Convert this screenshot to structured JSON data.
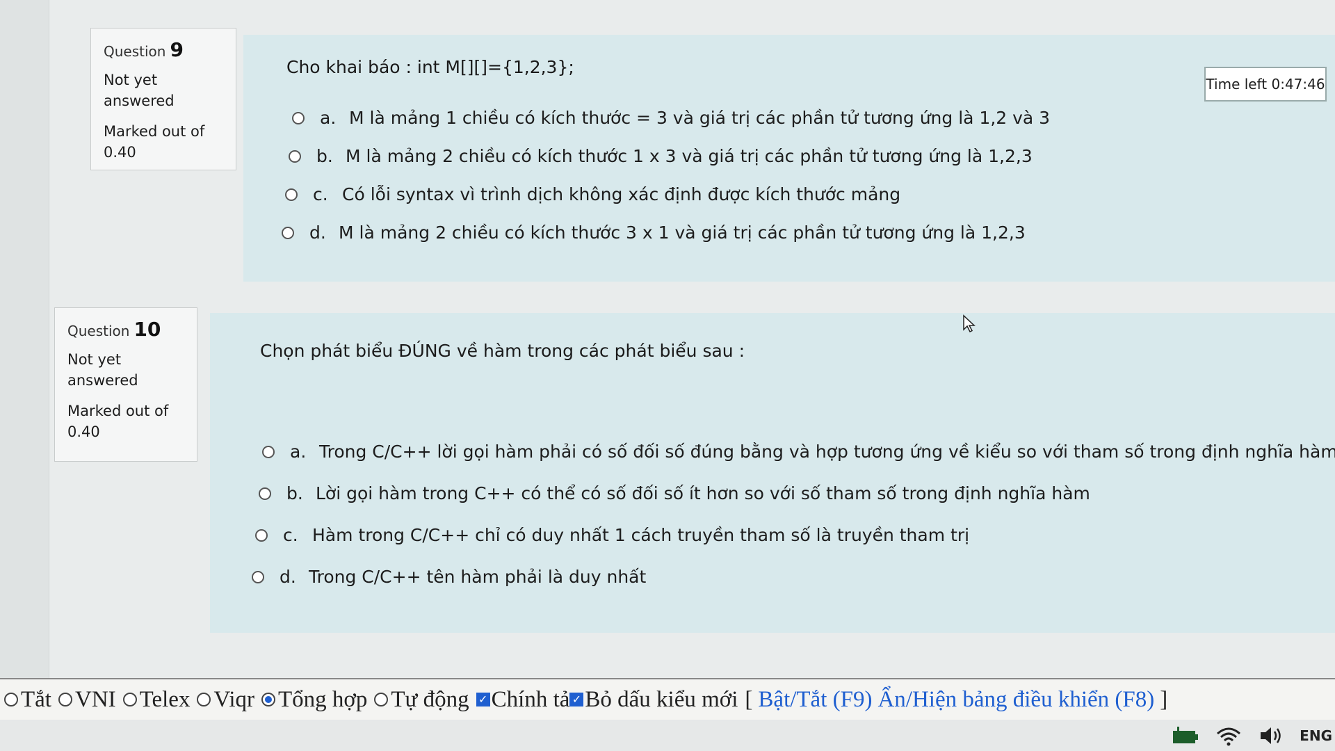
{
  "timer": {
    "label": "Time left 0:47:46"
  },
  "questions": [
    {
      "label": "Question",
      "number": "9",
      "state_line1": "Not yet",
      "state_line2": "answered",
      "mark_line1": "Marked out of",
      "mark_line2": "0.40",
      "text": "Cho khai báo : int M[][]={1,2,3};",
      "options": [
        {
          "letter": "a.",
          "text": "M là mảng 1 chiều có kích thước = 3 và giá trị các phần tử tương ứng là 1,2 và 3"
        },
        {
          "letter": "b.",
          "text": "M là mảng 2 chiều có kích thước 1 x 3 và giá trị các phần tử tương ứng là 1,2,3"
        },
        {
          "letter": "c.",
          "text": "Có lỗi syntax vì trình dịch không xác định được kích thước mảng"
        },
        {
          "letter": "d.",
          "text": "M là mảng 2 chiều có kích thước 3 x 1 và giá trị các phần tử tương ứng là 1,2,3"
        }
      ]
    },
    {
      "label": "Question",
      "number": "10",
      "state_line1": "Not yet",
      "state_line2": "answered",
      "mark_line1": "Marked out of",
      "mark_line2": "0.40",
      "text": "Chọn phát biểu ĐÚNG về hàm trong các phát biểu sau :",
      "options": [
        {
          "letter": "a.",
          "text": "Trong C/C++ lời gọi hàm phải có số đối số đúng bằng và hợp tương ứng về kiểu so với tham số trong định nghĩa hàm."
        },
        {
          "letter": "b.",
          "text": "Lời gọi hàm trong C++ có thể có số đối số ít hơn so với số tham số trong định nghĩa hàm"
        },
        {
          "letter": "c.",
          "text": "Hàm trong C/C++ chỉ có duy nhất 1 cách truyền tham số là truyền tham trị"
        },
        {
          "letter": "d.",
          "text": "Trong C/C++ tên hàm phải là duy nhất"
        }
      ]
    }
  ],
  "ime_bar": {
    "modes": [
      {
        "label": "Tắt",
        "selected": false
      },
      {
        "label": "VNI",
        "selected": false
      },
      {
        "label": "Telex",
        "selected": false
      },
      {
        "label": "Viqr",
        "selected": false
      },
      {
        "label": "Tổng hợp",
        "selected": true
      },
      {
        "label": "Tự động",
        "selected": false
      }
    ],
    "checks": [
      {
        "label": "Chính tả",
        "checked": true
      },
      {
        "label": "Bỏ dấu kiểu mới",
        "checked": true
      }
    ],
    "bracket_open": "[",
    "toggle_link": "Bật/Tắt (F9)",
    "panel_link": "Ẩn/Hiện bảng điều khiển (F8)",
    "bracket_close": "]"
  },
  "taskbar": {
    "icons": [
      "battery-icon",
      "wifi-icon",
      "volume-icon"
    ],
    "language": "ENG"
  }
}
